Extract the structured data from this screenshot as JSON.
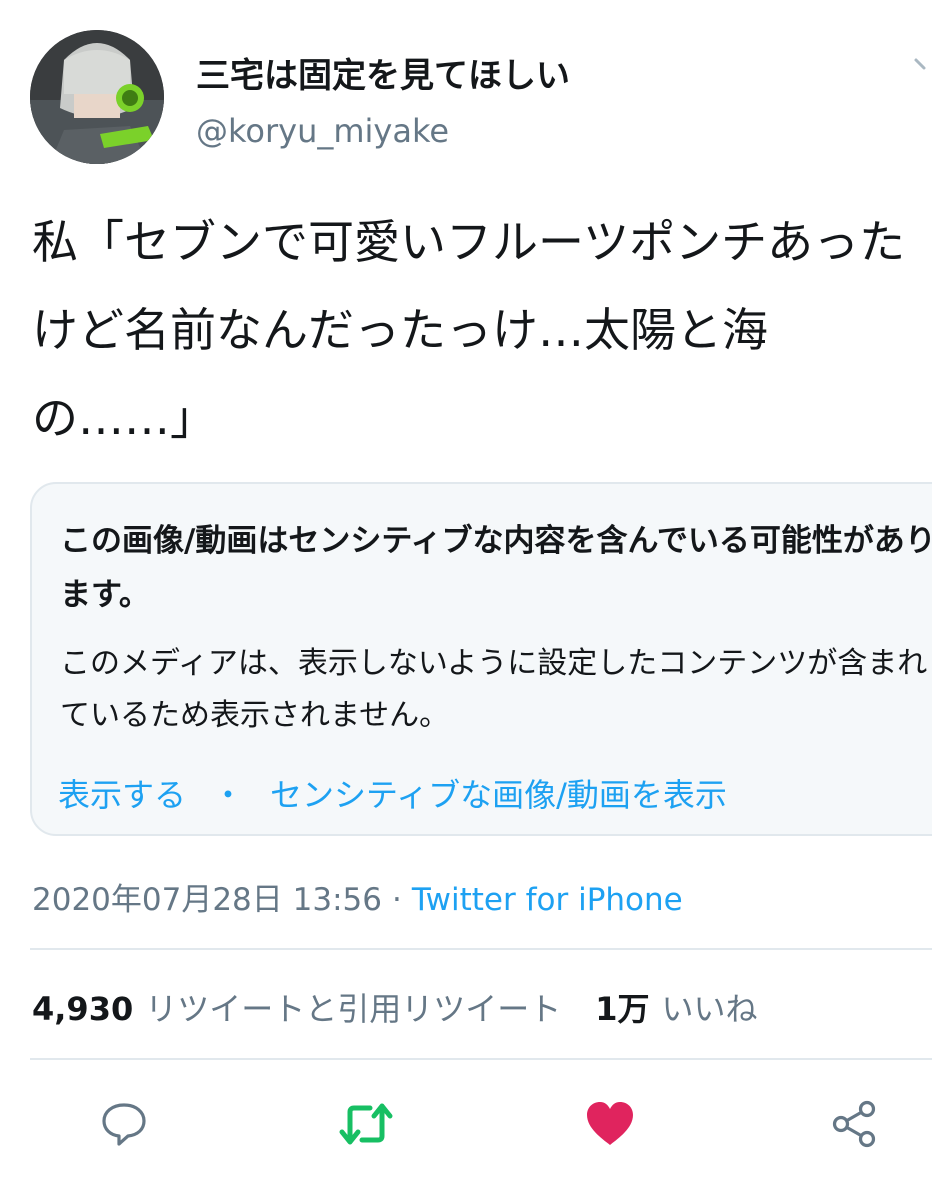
{
  "user": {
    "display_name": "三宅は固定を見てほしい",
    "handle": "@koryu_miyake"
  },
  "tweet": {
    "text": "私「セブンで可愛いフルーツポンチあったけど名前なんだったっけ…太陽と海の……」"
  },
  "sensitive_notice": {
    "title": "この画像/動画はセンシティブな内容を含んでいる可能性があります。",
    "body": "このメディアは、表示しないように設定したコンテンツが含まれているため表示されません。",
    "show_label": "表示する",
    "separator": "・",
    "settings_label": "センシティブな画像/動画を表示"
  },
  "meta": {
    "timestamp": "2020年07月28日 13:56",
    "dot": "·",
    "source": "Twitter for iPhone"
  },
  "stats": {
    "retweet_count": "4,930",
    "retweet_label": "リツイートと引用リツイート",
    "like_count": "1万",
    "like_label": "いいね"
  },
  "colors": {
    "accent": "#1da1f2",
    "retweet": "#17bf63",
    "like": "#e0245e",
    "secondary_text": "#657786"
  },
  "icons": [
    "reply-icon",
    "retweet-icon",
    "like-icon",
    "share-icon",
    "chevron-down-icon"
  ]
}
